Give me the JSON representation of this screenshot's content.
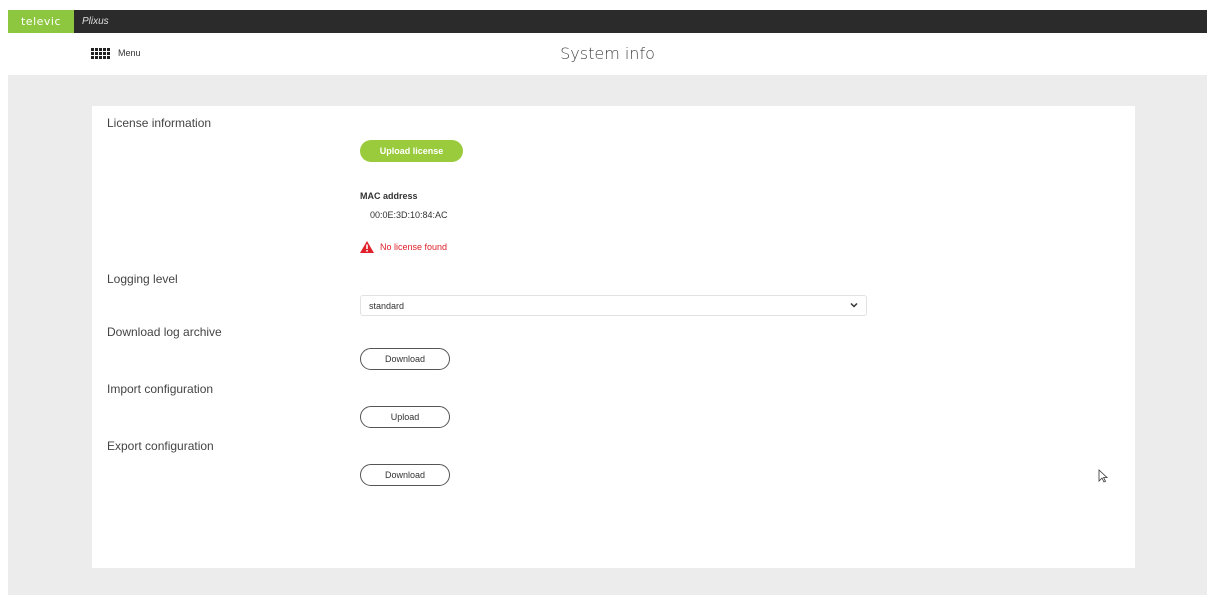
{
  "topbar": {
    "brand": "televic",
    "product": "Plixus"
  },
  "menu": {
    "label": "Menu"
  },
  "page": {
    "title": "System info"
  },
  "license": {
    "heading": "License information",
    "upload_button": "Upload license",
    "mac_label": "MAC address",
    "mac_value": "00:0E:3D:10:84:AC",
    "warning": "No license found"
  },
  "logging": {
    "heading": "Logging level",
    "selected": "standard"
  },
  "log_archive": {
    "heading": "Download log archive",
    "button": "Download"
  },
  "import_config": {
    "heading": "Import configuration",
    "button": "Upload"
  },
  "export_config": {
    "heading": "Export configuration",
    "button": "Download"
  },
  "colors": {
    "brand_green": "#8dc63f",
    "button_green": "#9acb3c",
    "warning_red": "#e0202a"
  }
}
